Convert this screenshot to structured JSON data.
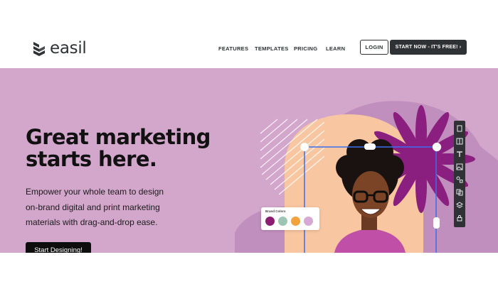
{
  "brand": {
    "name": "easil"
  },
  "nav": {
    "items": [
      {
        "label": "FEATURES"
      },
      {
        "label": "TEMPLATES"
      },
      {
        "label": "PRICING"
      },
      {
        "label": "LEARN"
      }
    ],
    "login_label": "LOGIN",
    "start_label": "START NOW - IT'S FREE! ›"
  },
  "hero": {
    "headline": [
      "Great marketing",
      "starts here."
    ],
    "subtext": [
      "Empower your whole team to design",
      "on-brand digital and print marketing",
      "materials with drag-and-drop ease."
    ],
    "cta_label": "Start Designing!"
  },
  "brand_colors": {
    "title": "Brand Colors",
    "swatches": [
      "#8b1c72",
      "#9ec5b4",
      "#f3a23d",
      "#d8a8d4"
    ]
  },
  "colors": {
    "hero_bg": "#d3a6cc",
    "accent_purple": "#8a1f7f",
    "peach": "#f8c6a0",
    "dark": "#2f3235"
  },
  "toolbar": {
    "icons": [
      "file-icon",
      "layout-icon",
      "text-icon",
      "image-icon",
      "shapes-icon",
      "copy-icon",
      "layers-icon",
      "lock-icon"
    ]
  }
}
